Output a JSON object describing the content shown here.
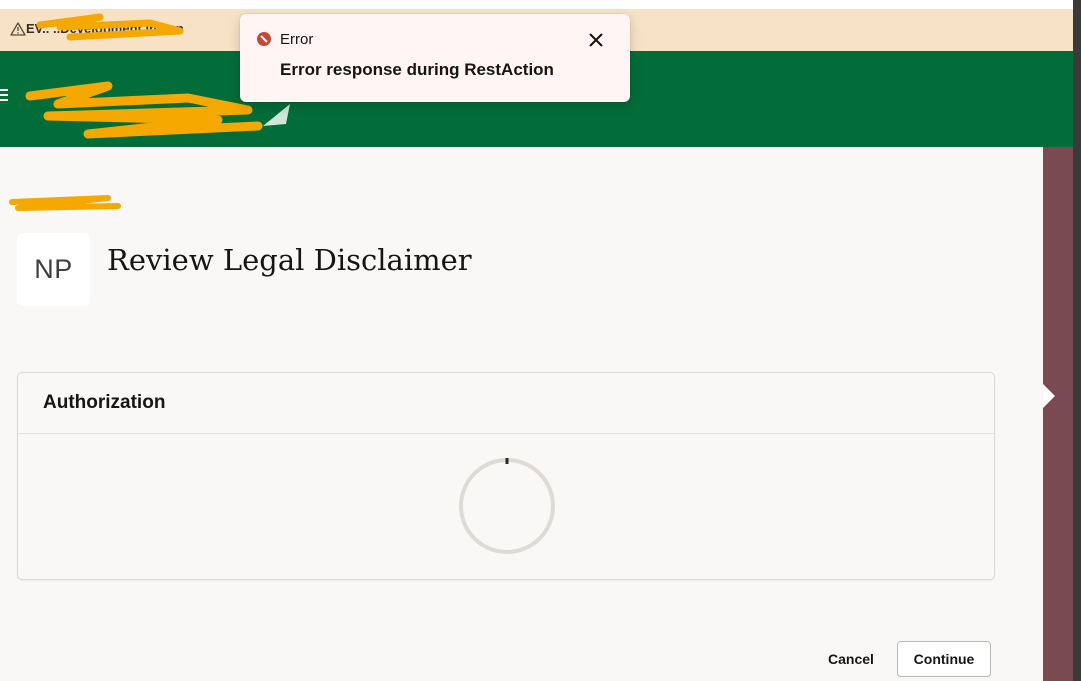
{
  "banner": {
    "text": "EV.. ..Development instan",
    "icon": "warning-triangle-icon",
    "color": "#f8e2c6"
  },
  "header": {
    "color": "#036d39",
    "menu_icon": "hamburger-menu-icon"
  },
  "toast": {
    "label": "Error",
    "message": "Error response during RestAction",
    "icon": "error-circle-icon",
    "close_icon": "close-icon",
    "status_color": "#c74634"
  },
  "page": {
    "avatar_initials": "NP",
    "title": "Review Legal Disclaimer"
  },
  "card": {
    "title": "Authorization",
    "loading": true
  },
  "actions": {
    "cancel_label": "Cancel",
    "continue_label": "Continue"
  },
  "colors": {
    "right_rail": "#7a4a52",
    "page_background": "#f9f8f6",
    "redaction": "#f5a800"
  }
}
